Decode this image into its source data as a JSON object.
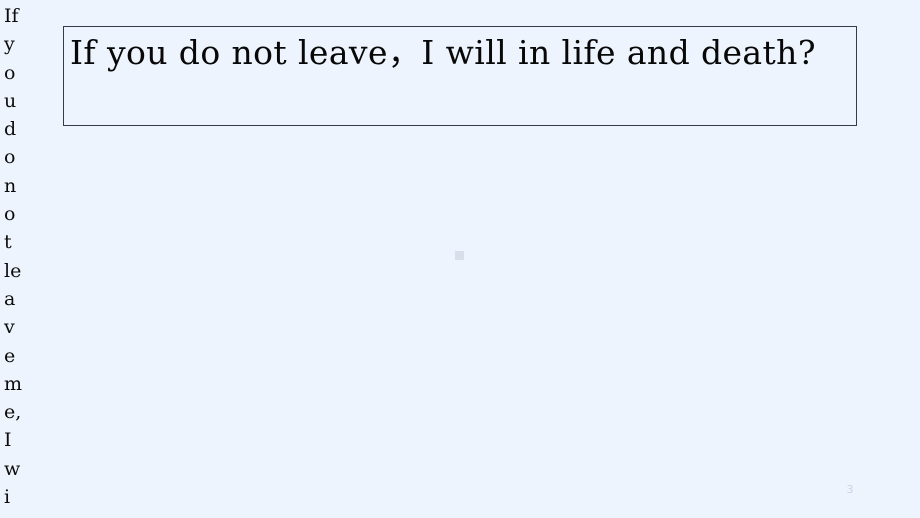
{
  "slide": {
    "background_color": "#eef4fd",
    "page_number": "3",
    "page_number_color": "#c9d4e6"
  },
  "overflow_column": {
    "name": "overflow-text-column",
    "text": "If you do not leave me, I wi",
    "text_color": "#0c0c0c",
    "characters": [
      "I",
      "f",
      "y",
      "o",
      "u",
      "d",
      "o",
      "n",
      "o",
      "t",
      "l",
      "e",
      "a",
      "v",
      "e",
      "m",
      "e,",
      "I",
      "w",
      "i"
    ]
  },
  "main_textbox": {
    "name": "main-text-box",
    "text": "If you do not leave，I will in life and death?",
    "line1": "If you do not leave，I will in life",
    "line2": "and death?",
    "text_color": "#080808",
    "border_color": "#333b4a",
    "fill_color": "#eef4fd"
  },
  "placeholder_mark": {
    "name": "placeholder-square",
    "color": "#d8dfea"
  }
}
